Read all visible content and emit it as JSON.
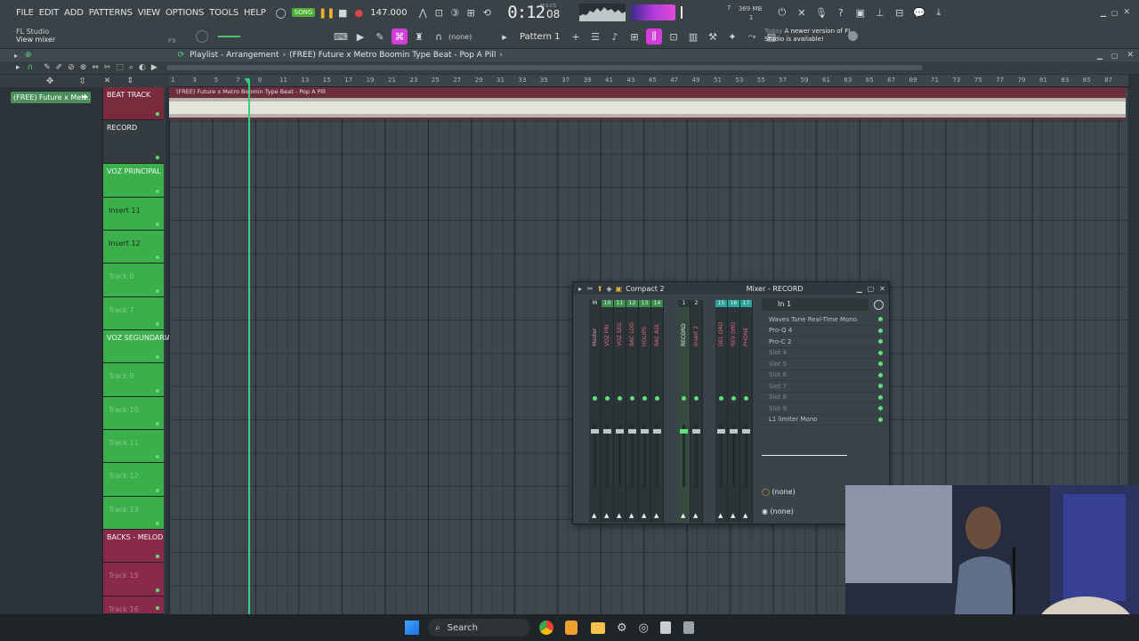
{
  "menu": [
    "FILE",
    "EDIT",
    "ADD",
    "PATTERNS",
    "VIEW",
    "OPTIONS",
    "TOOLS",
    "HELP"
  ],
  "hint": {
    "app": "FL Studio",
    "action": "View mixer",
    "shortcut": "F9"
  },
  "transport": {
    "mode": "SONG",
    "tempo": "147.000",
    "time": "0:12",
    "frames": "08",
    "time_unit": "M:S:CS"
  },
  "cpu": {
    "num": "7",
    "mem": "369 MB",
    "sub": "1"
  },
  "pattern": {
    "name": "Pattern 1",
    "snap": "(none)"
  },
  "news": {
    "label": "Today",
    "text": "A newer version of FL Studio is available!"
  },
  "playlist": {
    "breadcrumb": "Playlist - Arrangement",
    "project": "(FREE) Future x Metro Boomin Type Beat - Pop A Pill",
    "clip": "(FREE) Future x Metro Boomin Type Beat - Pop A Pill"
  },
  "browser": {
    "selected": "(FREE) Future x Metr..."
  },
  "ruler": [
    "1",
    "3",
    "5",
    "7",
    "9",
    "11",
    "13",
    "15",
    "17",
    "19",
    "21",
    "23",
    "25",
    "27",
    "29",
    "31",
    "33",
    "35",
    "37",
    "39",
    "41",
    "43",
    "45",
    "47",
    "49",
    "51",
    "53",
    "55",
    "57",
    "59",
    "61",
    "63",
    "65",
    "67",
    "69",
    "71",
    "73",
    "75",
    "77",
    "79",
    "81",
    "83",
    "85",
    "87"
  ],
  "tracks": [
    {
      "name": "BEAT TRACK",
      "color": "#7a2a3d",
      "header": true
    },
    {
      "name": "RECORD",
      "color": "#343c41",
      "header": true
    },
    {
      "name": "VOZ PRINCIPAL",
      "color": "#3bb04a",
      "header": true
    },
    {
      "name": "Insert 11",
      "color": "#3bb04a",
      "header": false
    },
    {
      "name": "Insert 12",
      "color": "#3bb04a",
      "header": false
    },
    {
      "name": "Track 6",
      "color": "#3bb04a",
      "header": false
    },
    {
      "name": "Track 7",
      "color": "#3bb04a",
      "header": false
    },
    {
      "name": "VOZ SEGUNDARIA",
      "color": "#3bb04a",
      "header": true
    },
    {
      "name": "Track 9",
      "color": "#3bb04a",
      "header": false
    },
    {
      "name": "Track 10",
      "color": "#3bb04a",
      "header": false
    },
    {
      "name": "Track 11",
      "color": "#3bb04a",
      "header": false
    },
    {
      "name": "Track 12",
      "color": "#3bb04a",
      "header": false
    },
    {
      "name": "Track 13",
      "color": "#3bb04a",
      "header": false
    },
    {
      "name": "BACKS - MELOD",
      "color": "#8a2a4a",
      "header": true
    },
    {
      "name": "Track 15",
      "color": "#8a2a4a",
      "header": false
    },
    {
      "name": "Track 16",
      "color": "#8a2a4a",
      "header": false
    }
  ],
  "mixer": {
    "preset": "Compact 2",
    "title": "Mixer - RECORD",
    "input": "In 1",
    "strips": [
      {
        "label": "Master",
        "num": "M"
      },
      {
        "label": "VOZ PRI",
        "num": "10"
      },
      {
        "label": "VOZ SEG",
        "num": "11"
      },
      {
        "label": "BAC LOO",
        "num": "12"
      },
      {
        "label": "HOLIPS",
        "num": "13"
      },
      {
        "label": "BAC ADL",
        "num": "14"
      },
      {
        "label": "RECORD",
        "num": "1"
      },
      {
        "label": "Insert 2",
        "num": "2"
      },
      {
        "label": "DEL ORD",
        "num": "15"
      },
      {
        "label": "REV ORD",
        "num": "16"
      },
      {
        "label": "PHONE",
        "num": "17"
      }
    ],
    "slots": [
      "Waves Tune Real-Time Mono",
      "Pro-Q 4",
      "Pro-C 2",
      "Slot 4",
      "Slot 5",
      "Slot 6",
      "Slot 7",
      "Slot 8",
      "Slot 9",
      "L1 limiter Mono"
    ],
    "send1": "(none)",
    "send2": "(none)"
  },
  "taskbar": {
    "search": "Search"
  },
  "colors": {
    "accent": "#d13fd8",
    "playhead": "#35d27c",
    "beat": "#7a2a3d",
    "voz": "#3bb04a",
    "backs": "#8a2a4a"
  }
}
